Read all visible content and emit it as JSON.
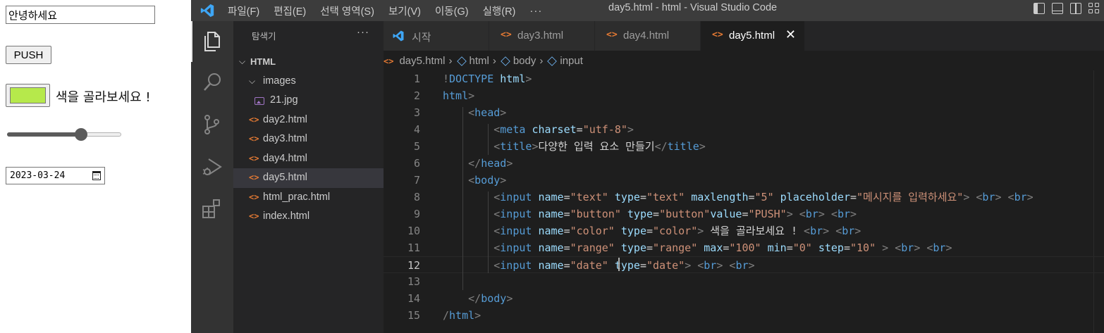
{
  "preview": {
    "text_input_value": "안녕하세요",
    "button_label": "PUSH",
    "color_value": "#b6e94b",
    "color_label": "색을 골라보세요 !",
    "range_percent": 65,
    "date_value": "2023-03-24"
  },
  "titlebar": {
    "menu": [
      "파일(F)",
      "편집(E)",
      "선택 영역(S)",
      "보기(V)",
      "이동(G)",
      "실행(R)"
    ],
    "more": "···",
    "window_title": "day5.html - html - Visual Studio Code"
  },
  "activity": [
    "explorer-icon",
    "search-icon",
    "source-control-icon",
    "run-debug-icon",
    "extensions-icon"
  ],
  "sidebar": {
    "title": "탐색기",
    "more": "···",
    "root": "HTML",
    "folder": "images",
    "files": [
      {
        "label": "21.jpg",
        "kind": "image"
      },
      {
        "label": "day2.html",
        "kind": "html"
      },
      {
        "label": "day3.html",
        "kind": "html"
      },
      {
        "label": "day4.html",
        "kind": "html"
      },
      {
        "label": "day5.html",
        "kind": "html",
        "selected": true
      },
      {
        "label": "html_prac.html",
        "kind": "html"
      },
      {
        "label": "index.html",
        "kind": "html"
      }
    ]
  },
  "tabs": [
    {
      "label": "시작",
      "kind": "vscode"
    },
    {
      "label": "day3.html",
      "kind": "html"
    },
    {
      "label": "day4.html",
      "kind": "html"
    },
    {
      "label": "day5.html",
      "kind": "html",
      "active": true
    }
  ],
  "breadcrumb": [
    "day5.html",
    "html",
    "body",
    "input"
  ],
  "editor": {
    "current_line": 12,
    "lines": [
      {
        "n": "1",
        "tokens": [
          [
            "gray",
            "!"
          ],
          [
            "tag",
            "DOCTYPE"
          ],
          [
            "txt",
            " "
          ],
          [
            "attr",
            "html"
          ],
          [
            "gray",
            ">"
          ]
        ]
      },
      {
        "n": "2",
        "tokens": [
          [
            "tag",
            "html"
          ],
          [
            "gray",
            ">"
          ]
        ]
      },
      {
        "n": "3",
        "tokens": [
          [
            "txt",
            "    "
          ],
          [
            "gray",
            "<"
          ],
          [
            "tag",
            "head"
          ],
          [
            "gray",
            ">"
          ]
        ]
      },
      {
        "n": "4",
        "tokens": [
          [
            "txt",
            "        "
          ],
          [
            "gray",
            "<"
          ],
          [
            "tag",
            "meta"
          ],
          [
            "txt",
            " "
          ],
          [
            "attr",
            "charset"
          ],
          [
            "txt",
            "="
          ],
          [
            "str",
            "\"utf-8\""
          ],
          [
            "gray",
            ">"
          ]
        ]
      },
      {
        "n": "5",
        "tokens": [
          [
            "txt",
            "        "
          ],
          [
            "gray",
            "<"
          ],
          [
            "tag",
            "title"
          ],
          [
            "gray",
            ">"
          ],
          [
            "txt",
            "다양한 입력 요소 만들기"
          ],
          [
            "gray",
            "</"
          ],
          [
            "tag",
            "title"
          ],
          [
            "gray",
            ">"
          ]
        ]
      },
      {
        "n": "6",
        "tokens": [
          [
            "txt",
            "    "
          ],
          [
            "gray",
            "</"
          ],
          [
            "tag",
            "head"
          ],
          [
            "gray",
            ">"
          ]
        ]
      },
      {
        "n": "7",
        "tokens": [
          [
            "txt",
            "    "
          ],
          [
            "gray",
            "<"
          ],
          [
            "tag",
            "body"
          ],
          [
            "gray",
            ">"
          ]
        ]
      },
      {
        "n": "8",
        "tokens": [
          [
            "txt",
            "        "
          ],
          [
            "gray",
            "<"
          ],
          [
            "tag",
            "input"
          ],
          [
            "txt",
            " "
          ],
          [
            "attr",
            "name"
          ],
          [
            "txt",
            "="
          ],
          [
            "str",
            "\"text\""
          ],
          [
            "txt",
            " "
          ],
          [
            "attr",
            "type"
          ],
          [
            "txt",
            "="
          ],
          [
            "str",
            "\"text\""
          ],
          [
            "txt",
            " "
          ],
          [
            "attr",
            "maxlength"
          ],
          [
            "txt",
            "="
          ],
          [
            "str",
            "\"5\""
          ],
          [
            "txt",
            " "
          ],
          [
            "attr",
            "placeholder"
          ],
          [
            "txt",
            "="
          ],
          [
            "str",
            "\"메시지를 입력하세요\""
          ],
          [
            "gray",
            ">"
          ],
          [
            "txt",
            " "
          ],
          [
            "gray",
            "<"
          ],
          [
            "tag",
            "br"
          ],
          [
            "gray",
            ">"
          ],
          [
            "txt",
            " "
          ],
          [
            "gray",
            "<"
          ],
          [
            "tag",
            "br"
          ],
          [
            "gray",
            ">"
          ]
        ]
      },
      {
        "n": "9",
        "tokens": [
          [
            "txt",
            "        "
          ],
          [
            "gray",
            "<"
          ],
          [
            "tag",
            "input"
          ],
          [
            "txt",
            " "
          ],
          [
            "attr",
            "name"
          ],
          [
            "txt",
            "="
          ],
          [
            "str",
            "\"button\""
          ],
          [
            "txt",
            " "
          ],
          [
            "attr",
            "type"
          ],
          [
            "txt",
            "="
          ],
          [
            "str",
            "\"button\""
          ],
          [
            "attr",
            "value"
          ],
          [
            "txt",
            "="
          ],
          [
            "str",
            "\"PUSH\""
          ],
          [
            "gray",
            ">"
          ],
          [
            "txt",
            " "
          ],
          [
            "gray",
            "<"
          ],
          [
            "tag",
            "br"
          ],
          [
            "gray",
            ">"
          ],
          [
            "txt",
            " "
          ],
          [
            "gray",
            "<"
          ],
          [
            "tag",
            "br"
          ],
          [
            "gray",
            ">"
          ]
        ]
      },
      {
        "n": "10",
        "tokens": [
          [
            "txt",
            "        "
          ],
          [
            "gray",
            "<"
          ],
          [
            "tag",
            "input"
          ],
          [
            "txt",
            " "
          ],
          [
            "attr",
            "name"
          ],
          [
            "txt",
            "="
          ],
          [
            "str",
            "\"color\""
          ],
          [
            "txt",
            " "
          ],
          [
            "attr",
            "type"
          ],
          [
            "txt",
            "="
          ],
          [
            "str",
            "\"color\""
          ],
          [
            "gray",
            ">"
          ],
          [
            "txt",
            " 색을 골라보세요 ! "
          ],
          [
            "gray",
            "<"
          ],
          [
            "tag",
            "br"
          ],
          [
            "gray",
            ">"
          ],
          [
            "txt",
            " "
          ],
          [
            "gray",
            "<"
          ],
          [
            "tag",
            "br"
          ],
          [
            "gray",
            ">"
          ]
        ]
      },
      {
        "n": "11",
        "tokens": [
          [
            "txt",
            "        "
          ],
          [
            "gray",
            "<"
          ],
          [
            "tag",
            "input"
          ],
          [
            "txt",
            " "
          ],
          [
            "attr",
            "name"
          ],
          [
            "txt",
            "="
          ],
          [
            "str",
            "\"range\""
          ],
          [
            "txt",
            " "
          ],
          [
            "attr",
            "type"
          ],
          [
            "txt",
            "="
          ],
          [
            "str",
            "\"range\""
          ],
          [
            "txt",
            " "
          ],
          [
            "attr",
            "max"
          ],
          [
            "txt",
            "="
          ],
          [
            "str",
            "\"100\""
          ],
          [
            "txt",
            " "
          ],
          [
            "attr",
            "min"
          ],
          [
            "txt",
            "="
          ],
          [
            "str",
            "\"0\""
          ],
          [
            "txt",
            " "
          ],
          [
            "attr",
            "step"
          ],
          [
            "txt",
            "="
          ],
          [
            "str",
            "\"10\""
          ],
          [
            "txt",
            " "
          ],
          [
            "gray",
            ">"
          ],
          [
            "txt",
            " "
          ],
          [
            "gray",
            "<"
          ],
          [
            "tag",
            "br"
          ],
          [
            "gray",
            ">"
          ],
          [
            "txt",
            " "
          ],
          [
            "gray",
            "<"
          ],
          [
            "tag",
            "br"
          ],
          [
            "gray",
            ">"
          ]
        ]
      },
      {
        "n": "12",
        "tokens": [
          [
            "txt",
            "        "
          ],
          [
            "gray",
            "<"
          ],
          [
            "tag",
            "input"
          ],
          [
            "txt",
            " "
          ],
          [
            "attr",
            "name"
          ],
          [
            "txt",
            "="
          ],
          [
            "str",
            "\"date\""
          ],
          [
            "txt",
            " "
          ],
          [
            "attr",
            "type"
          ],
          [
            "txt",
            "="
          ],
          [
            "str",
            "\"date\""
          ],
          [
            "gray",
            ">"
          ],
          [
            "txt",
            " "
          ],
          [
            "gray",
            "<"
          ],
          [
            "tag",
            "br"
          ],
          [
            "gray",
            ">"
          ],
          [
            "txt",
            " "
          ],
          [
            "gray",
            "<"
          ],
          [
            "tag",
            "br"
          ],
          [
            "gray",
            ">"
          ]
        ]
      },
      {
        "n": "13",
        "tokens": []
      },
      {
        "n": "14",
        "tokens": [
          [
            "txt",
            "    "
          ],
          [
            "gray",
            "</"
          ],
          [
            "tag",
            "body"
          ],
          [
            "gray",
            ">"
          ]
        ]
      },
      {
        "n": "15",
        "tokens": [
          [
            "gray",
            "/"
          ],
          [
            "tag",
            "html"
          ],
          [
            "gray",
            ">"
          ]
        ]
      }
    ]
  }
}
